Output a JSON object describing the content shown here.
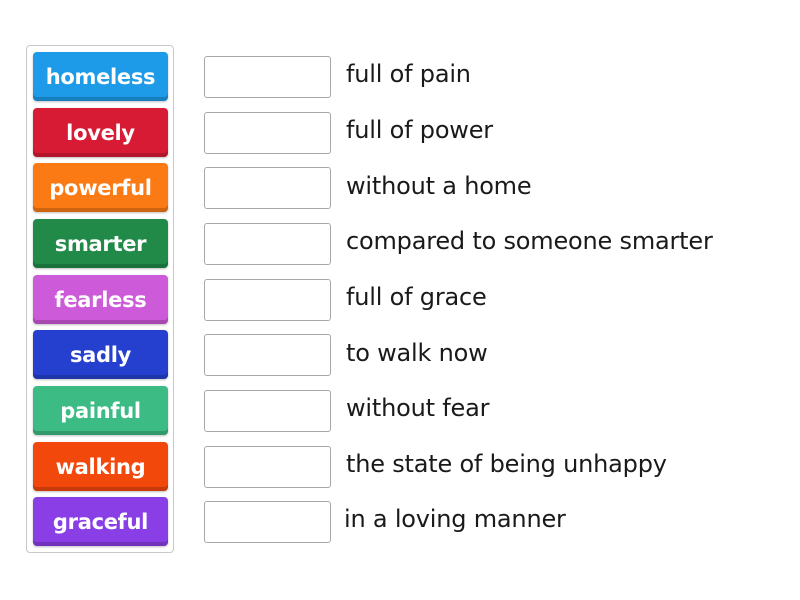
{
  "tiles": [
    {
      "label": "homeless",
      "color": "#1e9be8"
    },
    {
      "label": "lovely",
      "color": "#d81b34"
    },
    {
      "label": "powerful",
      "color": "#fb7a14"
    },
    {
      "label": "smarter",
      "color": "#218a48"
    },
    {
      "label": "fearless",
      "color": "#cd5ad8"
    },
    {
      "label": "sadly",
      "color": "#2540cf"
    },
    {
      "label": "painful",
      "color": "#3cbc84"
    },
    {
      "label": "walking",
      "color": "#f2480c"
    },
    {
      "label": "graceful",
      "color": "#8a3fe6"
    }
  ],
  "rows": [
    {
      "slot_value": "",
      "clue": "full of pain"
    },
    {
      "slot_value": "",
      "clue": "full of power"
    },
    {
      "slot_value": "",
      "clue": "without a home"
    },
    {
      "slot_value": "",
      "clue": "compared to someone smarter"
    },
    {
      "slot_value": "",
      "clue": "full of grace"
    },
    {
      "slot_value": "",
      "clue": "to walk now"
    },
    {
      "slot_value": "",
      "clue": "without fear"
    },
    {
      "slot_value": "",
      "clue": "the state of being unhappy"
    },
    {
      "slot_value": "",
      "clue": "in a loving manner"
    }
  ]
}
